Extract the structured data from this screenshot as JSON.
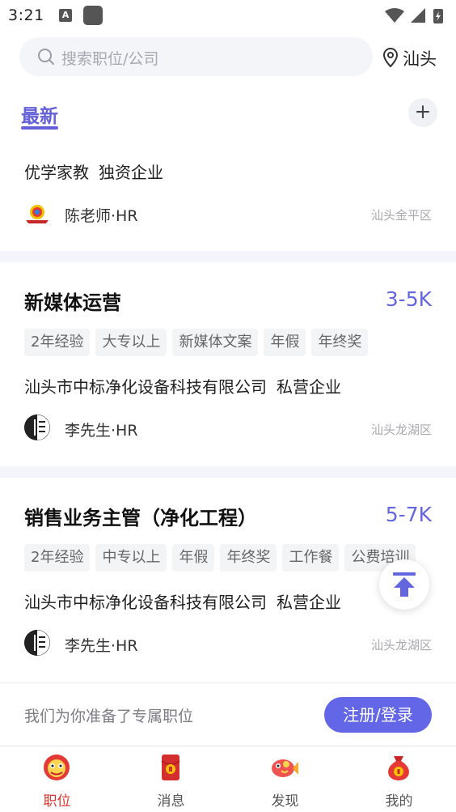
{
  "status_bar": {
    "time": "3:21",
    "ime_icon": "A"
  },
  "search": {
    "placeholder": "搜索职位/公司"
  },
  "location": {
    "city": "汕头"
  },
  "tabs": {
    "latest": "最新",
    "add_label": "+"
  },
  "partial_card": {
    "company": "优学家教",
    "company_type": "独资企业",
    "hr": "陈老师·HR",
    "district": "汕头金平区"
  },
  "jobs": [
    {
      "title": "新媒体运营",
      "salary": "3-5K",
      "tags": [
        "2年经验",
        "大专以上",
        "新媒体文案",
        "年假",
        "年终奖"
      ],
      "company": "汕头市中标净化设备科技有限公司",
      "company_type": "私营企业",
      "hr": "李先生·HR",
      "district": "汕头龙湖区"
    },
    {
      "title": "销售业务主管（净化工程）",
      "salary": "5-7K",
      "tags": [
        "2年经验",
        "中专以上",
        "年假",
        "年终奖",
        "工作餐",
        "公费培训"
      ],
      "company": "汕头市中标净化设备科技有限公司",
      "company_type": "私营企业",
      "hr": "李先生·HR",
      "district": "汕头龙湖区"
    }
  ],
  "login_banner": {
    "text": "我们为你准备了专属职位",
    "button": "注册/登录"
  },
  "bottom_nav": [
    {
      "label": "职位",
      "icon": "lion-dance-icon",
      "active": true
    },
    {
      "label": "消息",
      "icon": "red-envelope-icon",
      "active": false
    },
    {
      "label": "发现",
      "icon": "fish-icon",
      "active": false
    },
    {
      "label": "我的",
      "icon": "money-bag-icon",
      "active": false
    }
  ],
  "colors": {
    "accent": "#6466e0",
    "nav_active": "#e0332b"
  }
}
